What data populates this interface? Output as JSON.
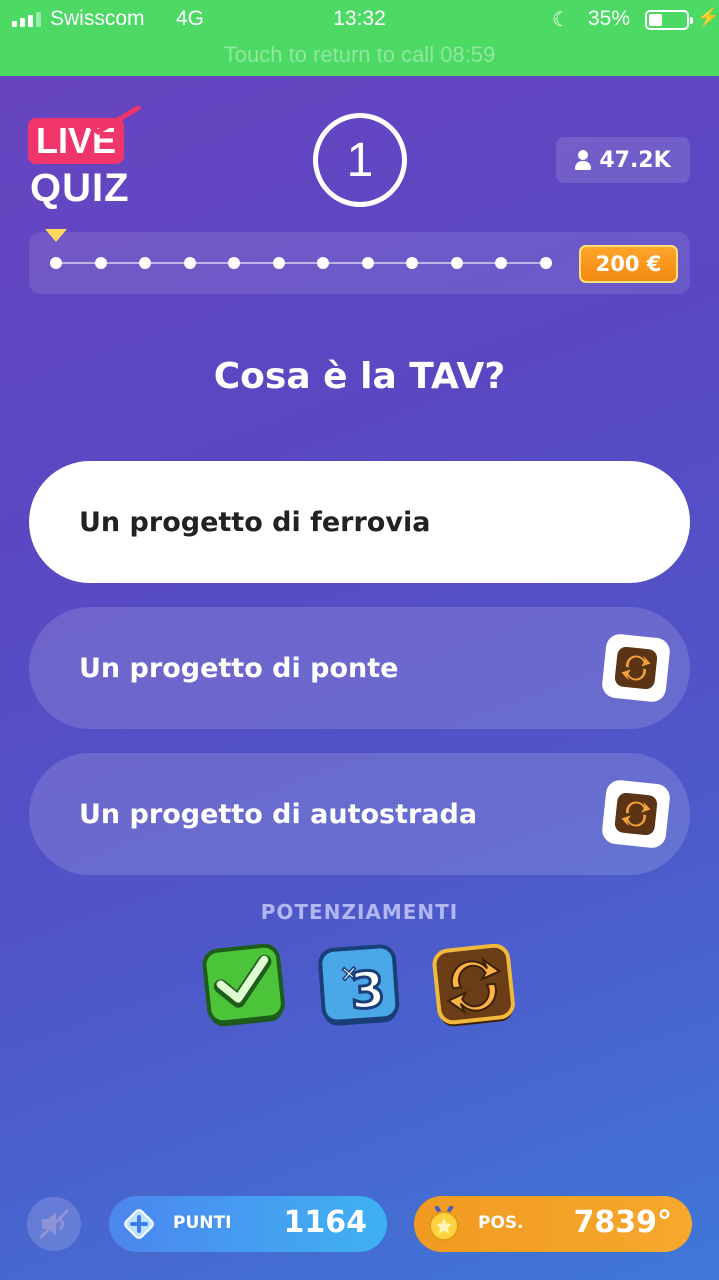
{
  "status_bar": {
    "carrier": "Swisscom",
    "network": "4G",
    "time": "13:32",
    "battery": "35%",
    "call_banner": "Touch to return to call 08:59"
  },
  "header": {
    "logo_top": "LIVE",
    "logo_bottom": "QUIZ",
    "round_number": "1",
    "viewers": "47.2K"
  },
  "progress": {
    "steps": 12,
    "current_step": 1,
    "prize": "200 €"
  },
  "question": "Cosa è la TAV?",
  "answers": [
    {
      "label": "Un progetto di ferrovia",
      "selected": true
    },
    {
      "label": "Un progetto di ponte",
      "selected": false,
      "icon": "swap-question-icon"
    },
    {
      "label": "Un progetto di autostrada",
      "selected": false,
      "icon": "swap-question-icon"
    }
  ],
  "powerups": {
    "title": "POTENZIAMENTI",
    "items": [
      {
        "name": "correct-answer-powerup",
        "icon": "checkmark-icon"
      },
      {
        "name": "extra-life-powerup",
        "icon": "times-three-icon"
      },
      {
        "name": "swap-question-powerup",
        "icon": "swap-icon"
      }
    ]
  },
  "footer": {
    "points_label": "PUNTI",
    "points_value": "1164",
    "position_label": "POS.",
    "position_value": "7839°"
  },
  "colors": {
    "status_green": "#4cd964",
    "live_pink": "#f0356a",
    "prize_orange": "#f38a12",
    "points_blue": "#4c86ee",
    "position_orange": "#f29a22"
  }
}
